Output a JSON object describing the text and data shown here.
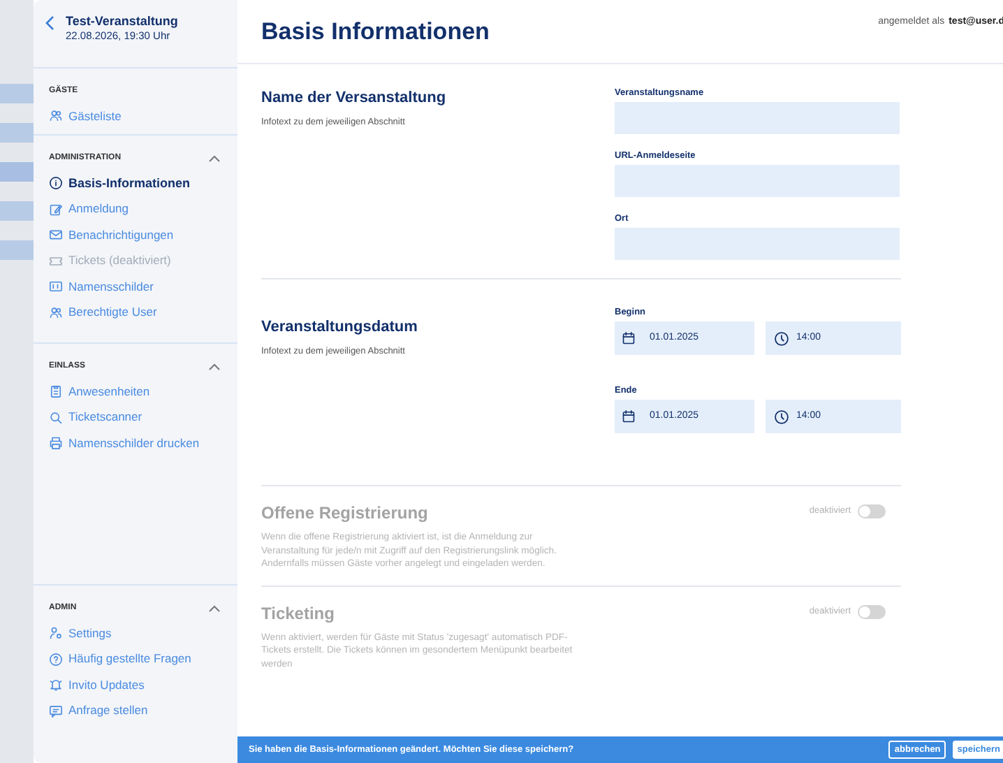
{
  "event": {
    "title": "Test-Veranstaltung",
    "date": "22.08.2026, 19:30 Uhr"
  },
  "sidebar": {
    "groups": [
      {
        "heading": "GÄSTE",
        "items": [
          {
            "label": "Gästeliste",
            "selected": false,
            "disabled": false
          }
        ]
      },
      {
        "heading": "ADMINISTRATION",
        "expanded": true,
        "items": [
          {
            "label": "Basis-Informationen",
            "selected": true,
            "disabled": false
          },
          {
            "label": "Anmeldung",
            "selected": false,
            "disabled": false
          },
          {
            "label": "Benachrichtigungen",
            "selected": false,
            "disabled": false
          },
          {
            "label": "Tickets (deaktiviert)",
            "selected": false,
            "disabled": true
          },
          {
            "label": "Namensschilder",
            "selected": false,
            "disabled": false
          },
          {
            "label": "Berechtigte User",
            "selected": false,
            "disabled": false
          }
        ]
      },
      {
        "heading": "EINLASS",
        "expanded": true,
        "items": [
          {
            "label": "Anwesenheiten",
            "selected": false,
            "disabled": false
          },
          {
            "label": "Ticketscanner",
            "selected": false,
            "disabled": false
          },
          {
            "label": "Namensschilder drucken",
            "selected": false,
            "disabled": false
          }
        ]
      },
      {
        "heading": "ADMIN",
        "expanded": true,
        "items": [
          {
            "label": "Settings",
            "selected": false,
            "disabled": false
          },
          {
            "label": "Häufig gestellte Fragen",
            "selected": false,
            "disabled": false
          },
          {
            "label": "Invito Updates",
            "selected": false,
            "disabled": false
          },
          {
            "label": "Anfrage stellen",
            "selected": false,
            "disabled": false
          }
        ]
      }
    ]
  },
  "header": {
    "title": "Basis Informationen",
    "login_label": "angemeldet als",
    "user": "test@user.d"
  },
  "sections": [
    {
      "kind": "fields",
      "title": "Name der Versanstaltung",
      "info": "Infotext zu dem jeweiligen Abschnitt",
      "fields": [
        {
          "kind": "text",
          "label": "Veranstaltungsname"
        },
        {
          "kind": "text",
          "label": "URL-Anmeldeseite"
        },
        {
          "kind": "text",
          "label": "Ort"
        }
      ]
    },
    {
      "kind": "fields",
      "title": "Veranstaltungsdatum",
      "info": "Infotext zu dem jeweiligen Abschnitt",
      "fields": [
        {
          "kind": "datetime",
          "label": "Beginn",
          "date": "01.01.2025",
          "time": "14:00"
        },
        {
          "kind": "datetime",
          "label": "Ende",
          "date": "01.01.2025",
          "time": "14:00"
        }
      ]
    },
    {
      "kind": "toggle",
      "title": "Offene Registrierung",
      "info": "Wenn die offene Registrierung aktiviert ist, ist die Anmeldung zur Veranstaltung für jede/n mit Zugriff auf den Registrierungslink möglich. Andernfalls müssen Gäste vorher angelegt und eingeladen werden.",
      "state_label": "deaktiviert",
      "on": false,
      "disabled": true
    },
    {
      "kind": "toggle",
      "title": "Ticketing",
      "info": "Wenn aktiviert, werden für Gäste mit Status 'zugesagt' automatisch PDF-Tickets erstellt. Die Tickets können im gesondertem Menüpunkt bearbeitet werden",
      "state_label": "deaktiviert",
      "on": false,
      "disabled": true
    }
  ],
  "save_bar": {
    "message": "Sie haben die Basis-Informationen geändert. Möchten Sie diese speichern?",
    "cancel": "abbrechen",
    "save": "speichern"
  }
}
